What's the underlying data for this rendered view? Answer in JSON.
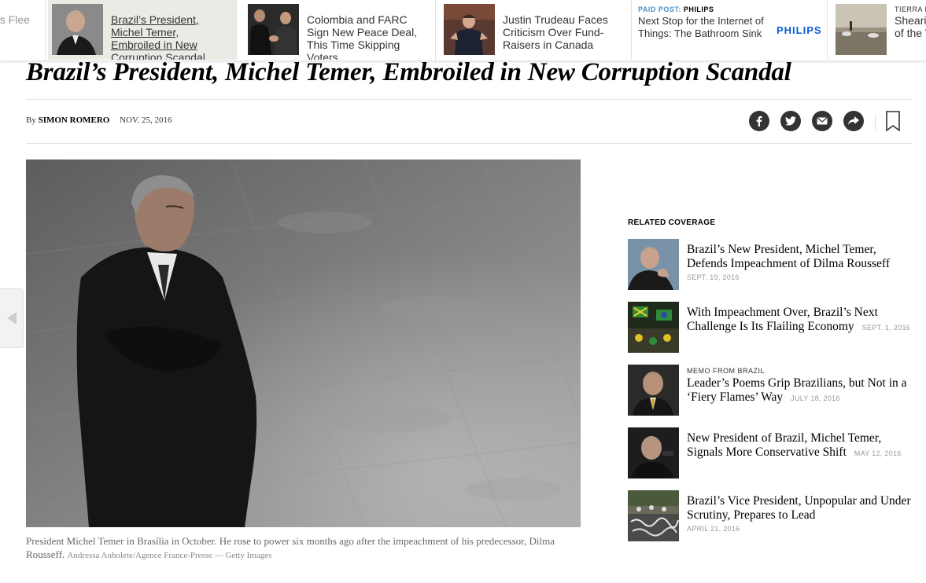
{
  "ribbon": {
    "items": [
      {
        "text": "ns Flee"
      },
      {
        "text": "Brazil’s President, Michel Temer, Embroiled in New Corruption Scandal"
      },
      {
        "text": "Colombia and FARC Sign New Peace Deal, This Time Skipping Voters"
      },
      {
        "text": "Justin Trudeau Faces Criticism Over Fund-Raisers in Canada"
      }
    ],
    "paid": {
      "label": "PAID POST:",
      "brand": "PHILIPS",
      "text": "Next Stop for the Internet of Things: The Bathroom Sink",
      "logo": "PHILIPS"
    },
    "tierra": {
      "label": "TIERRA D",
      "text_line1": "Shearin",
      "text_line2": "of the V"
    }
  },
  "article": {
    "headline": "Brazil’s President, Michel Temer, Embroiled in New Corruption Scandal",
    "by": "By",
    "author": "SIMON ROMERO",
    "date": "NOV. 25, 2016",
    "caption": "President Michel Temer in Brasília in October. He rose to power six months ago after the impeachment of his predecessor, Dilma Rousseff.",
    "credit": "Andressa Anholete/Agence France-Presse — Getty Images"
  },
  "share": {
    "icons": [
      "facebook-icon",
      "twitter-icon",
      "email-icon",
      "share-icon"
    ]
  },
  "related": {
    "title": "RELATED COVERAGE",
    "items": [
      {
        "kicker": "",
        "headline": "Brazil’s New President, Michel Temer, Defends Impeachment of Dilma Rousseff",
        "date": "SEPT. 19, 2016"
      },
      {
        "kicker": "",
        "headline": "With Impeachment Over, Brazil’s Next Challenge Is Its Flailing Economy",
        "date": "SEPT. 1, 2016"
      },
      {
        "kicker": "MEMO FROM BRAZIL",
        "headline": "Leader’s Poems Grip Brazilians, but Not in a ‘Fiery Flames’ Way",
        "date": "JULY 18, 2016"
      },
      {
        "kicker": "",
        "headline": "New President of Brazil, Michel Temer, Signals More Conservative Shift",
        "date": "MAY 12, 2016"
      },
      {
        "kicker": "",
        "headline": "Brazil’s Vice President, Unpopular and Under Scrutiny, Prepares to Lead",
        "date": "APRIL 21, 2016"
      }
    ]
  },
  "colors": {
    "share_bg": "#333333",
    "paid_label": "#4a90c9",
    "philips_blue": "#0b5ed7",
    "ribbon_active": "#ebebe6"
  }
}
